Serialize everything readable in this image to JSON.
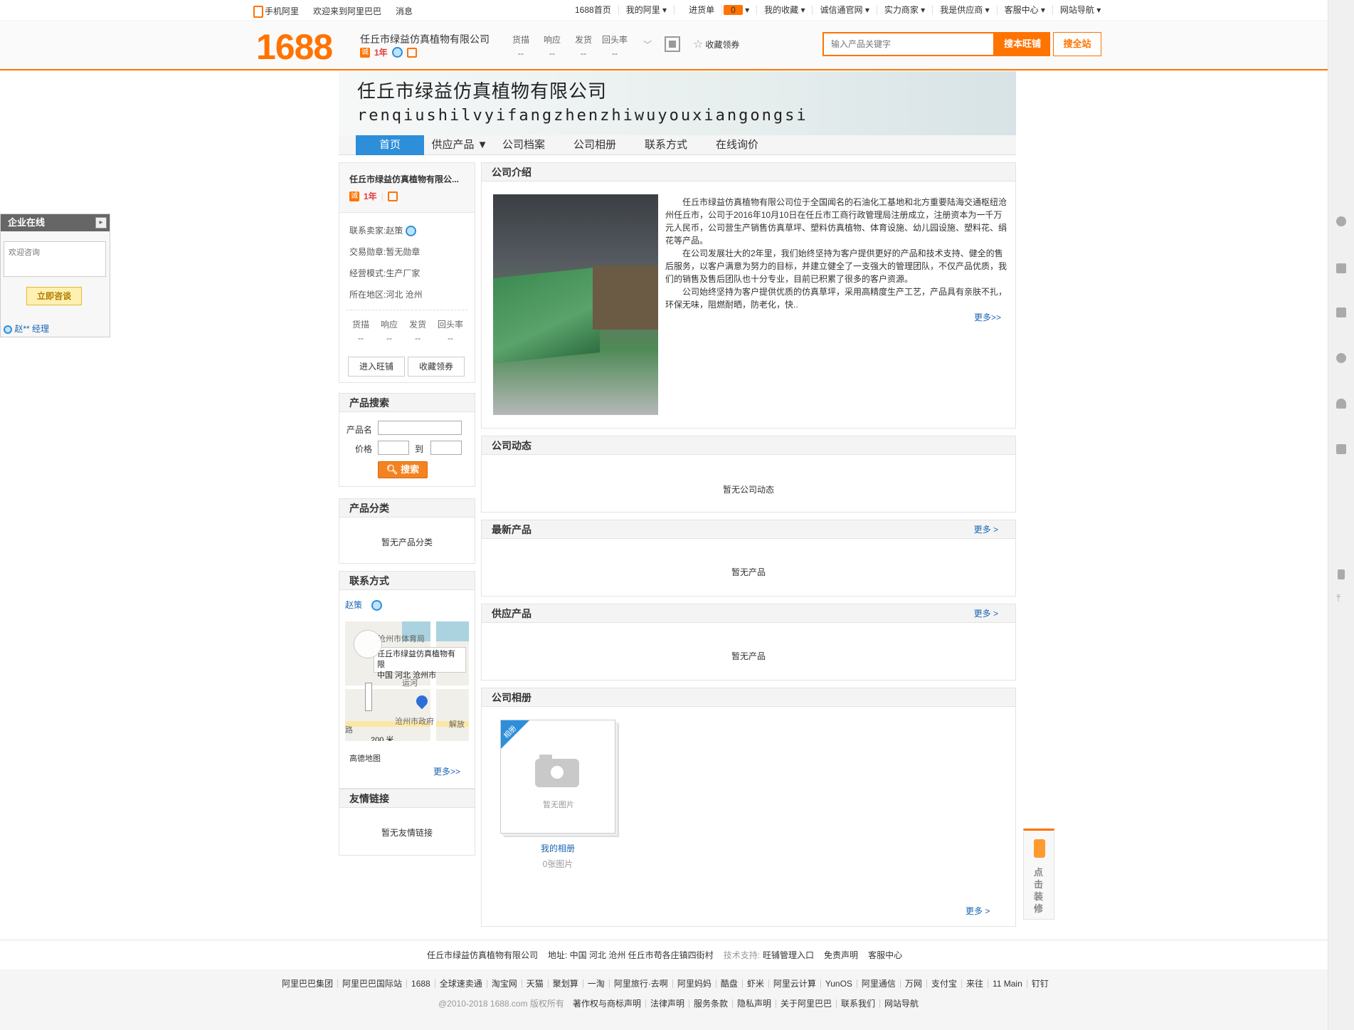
{
  "topbar": {
    "left": [
      "手机阿里",
      "欢迎来到阿里巴巴",
      "消息"
    ],
    "right": [
      "1688首页",
      "我的阿里 ▾",
      "进货单",
      "我的收藏 ▾",
      "诚信通官网 ▾",
      "实力商家 ▾",
      "我是供应商 ▾",
      "客服中心 ▾",
      "网站导航 ▾"
    ],
    "cart_count": "0"
  },
  "header": {
    "logo": "1688",
    "shop_name": "任丘市绿益仿真植物有限公司",
    "years": "1年",
    "metrics": [
      {
        "label": "货描",
        "value": "--"
      },
      {
        "label": "响应",
        "value": "--"
      },
      {
        "label": "发货",
        "value": "--"
      },
      {
        "label": "回头率",
        "value": "--"
      }
    ],
    "favorite": "收藏领券",
    "search_placeholder": "输入产品关键字",
    "btn_shop": "搜本旺铺",
    "btn_all": "搜全站"
  },
  "banner": {
    "cn": "任丘市绿益仿真植物有限公司",
    "en": "renqiushilvyifangzhenzhiwuyouxiangongsi"
  },
  "nav": [
    "首页",
    "供应产品 ▼",
    "公司档案",
    "公司相册",
    "联系方式",
    "在线询价"
  ],
  "profile": {
    "title": "任丘市绿益仿真植物有限公...",
    "years": "1年",
    "seller": "联系卖家:赵策",
    "medal": "交易勋章:暂无勋章",
    "mode": "经营模式:生产厂家",
    "region": "所在地区:河北 沧州",
    "metrics": [
      {
        "label": "货描",
        "value": "--"
      },
      {
        "label": "响应",
        "value": "--"
      },
      {
        "label": "发货",
        "value": "--"
      },
      {
        "label": "回头率",
        "value": "--"
      }
    ],
    "btn_enter": "进入旺铺",
    "btn_fav": "收藏领券"
  },
  "product_search": {
    "title": "产品搜索",
    "name_label": "产品名",
    "price_label": "价格",
    "to_label": "到",
    "btn": "搜索"
  },
  "category": {
    "title": "产品分类",
    "empty": "暂无产品分类"
  },
  "contact": {
    "title": "联系方式",
    "name": "赵策",
    "map_popup_1": "任丘市绿益仿真植物有限",
    "map_popup_2": "中国 河北 沧州市",
    "map_label_1": "沧州市体育局",
    "map_label_2": "沧州市政府",
    "map_label_3": "解放",
    "map_label_4": "路",
    "map_label_5": "运河",
    "map_scale": "200 米",
    "map_logo": "高德地图",
    "more": "更多>>"
  },
  "links": {
    "title": "友情链接",
    "empty": "暂无友情链接"
  },
  "intro": {
    "title": "公司介绍",
    "p1": "任丘市绿益仿真植物有限公司位于全国闻名的石油化工基地和北方重要陆海交通枢纽沧州任丘市，公司于2016年10月10日在任丘市工商行政管理局注册成立，注册资本为一千万元人民币，公司营生产销售仿真草坪、塑料仿真植物、体育设施、幼儿园设施、塑料花、绢花等产品。",
    "p2": "在公司发展壮大的2年里，我们始终坚持为客户提供更好的产品和技术支持、健全的售后服务，以客户满意为努力的目标，并建立健全了一支强大的管理团队，不仅产品优质，我们的销售及售后团队也十分专业，目前已积累了很多的客户资源。",
    "p3": "公司始终坚持为客户提供优质的仿真草坪，采用高精度生产工艺，产品具有亲肤不扎，环保无味，阻燃耐晒，防老化，快..",
    "more": "更多>>"
  },
  "news": {
    "title": "公司动态",
    "empty": "暂无公司动态"
  },
  "newest": {
    "title": "最新产品",
    "more": "更多 >",
    "empty": "暂无产品"
  },
  "supply": {
    "title": "供应产品",
    "more": "更多 >",
    "empty": "暂无产品"
  },
  "album": {
    "title": "公司相册",
    "corner": "相册",
    "nopic": "暂无图片",
    "name": "我的相册",
    "count": "0张图片",
    "more": "更多 >"
  },
  "online": {
    "title": "企业在线",
    "placeholder": "欢迎咨询",
    "btn": "立即咨谈",
    "user": "赵** 经理"
  },
  "decorate": "点击装修",
  "footer": {
    "company": "任丘市绿益仿真植物有限公司",
    "address": "地址:  中国 河北 沧州 任丘市苟各庄镇四街村",
    "tech": "技术支持:",
    "tech_links": [
      "旺铺管理入口",
      "免责声明",
      "客服中心"
    ],
    "links": [
      "阿里巴巴集团",
      "阿里巴巴国际站",
      "1688",
      "全球速卖通",
      "淘宝网",
      "天猫",
      "聚划算",
      "一淘",
      "阿里旅行·去啊",
      "阿里妈妈",
      "酷盘",
      "虾米",
      "阿里云计算",
      "YunOS",
      "阿里通信",
      "万网",
      "支付宝",
      "来往",
      "11 Main",
      "钉钉"
    ],
    "copyright": "@2010-2018 1688.com 版权所有",
    "bottom": [
      "著作权与商标声明",
      "法律声明",
      "服务条款",
      "隐私声明",
      "关于阿里巴巴",
      "联系我们",
      "网站导航"
    ]
  }
}
